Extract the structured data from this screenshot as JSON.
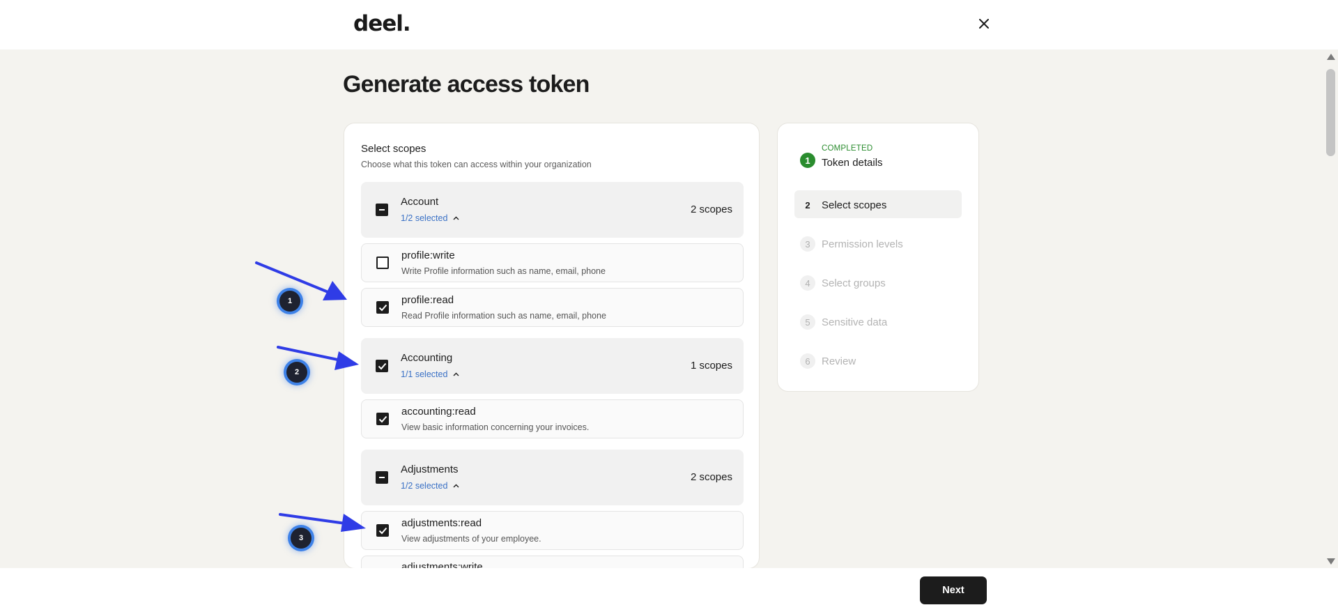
{
  "header": {
    "logo": "deel.",
    "close_icon": "close-icon"
  },
  "page": {
    "title": "Generate access token"
  },
  "scopes_panel": {
    "title": "Select scopes",
    "subtitle": "Choose what this token can access within your organization",
    "groups": [
      {
        "name": "Account",
        "selected": "1/2 selected",
        "count": "2 scopes",
        "state": "indeterminate"
      },
      {
        "name": "Accounting",
        "selected": "1/1 selected",
        "count": "1 scopes",
        "state": "checked"
      },
      {
        "name": "Adjustments",
        "selected": "1/2 selected",
        "count": "2 scopes",
        "state": "indeterminate"
      }
    ],
    "items": [
      {
        "name": "profile:write",
        "desc": "Write Profile information such as name, email, phone",
        "checked": false
      },
      {
        "name": "profile:read",
        "desc": "Read Profile information such as name, email, phone",
        "checked": true
      },
      {
        "name": "accounting:read",
        "desc": "View basic information concerning your invoices.",
        "checked": true
      },
      {
        "name": "adjustments:read",
        "desc": "View adjustments of your employee.",
        "checked": true
      },
      {
        "name": "adjustments:write",
        "desc": "",
        "checked": false
      }
    ]
  },
  "steps": [
    {
      "num": "1",
      "status": "COMPLETED",
      "label": "Token details",
      "state": "done"
    },
    {
      "num": "2",
      "label": "Select scopes",
      "state": "current"
    },
    {
      "num": "3",
      "label": "Permission levels",
      "state": "pending"
    },
    {
      "num": "4",
      "label": "Select groups",
      "state": "pending"
    },
    {
      "num": "5",
      "label": "Sensitive data",
      "state": "pending"
    },
    {
      "num": "6",
      "label": "Review",
      "state": "pending"
    }
  ],
  "footer": {
    "next_label": "Next"
  },
  "annotations": {
    "badges": [
      "1",
      "2",
      "3"
    ],
    "arrow_color": "#2f3ce6"
  },
  "colors": {
    "accent_link": "#3970c5",
    "completed_green": "#2a8c2e",
    "primary_button": "#1c1c1c",
    "background": "#f4f3ef"
  }
}
